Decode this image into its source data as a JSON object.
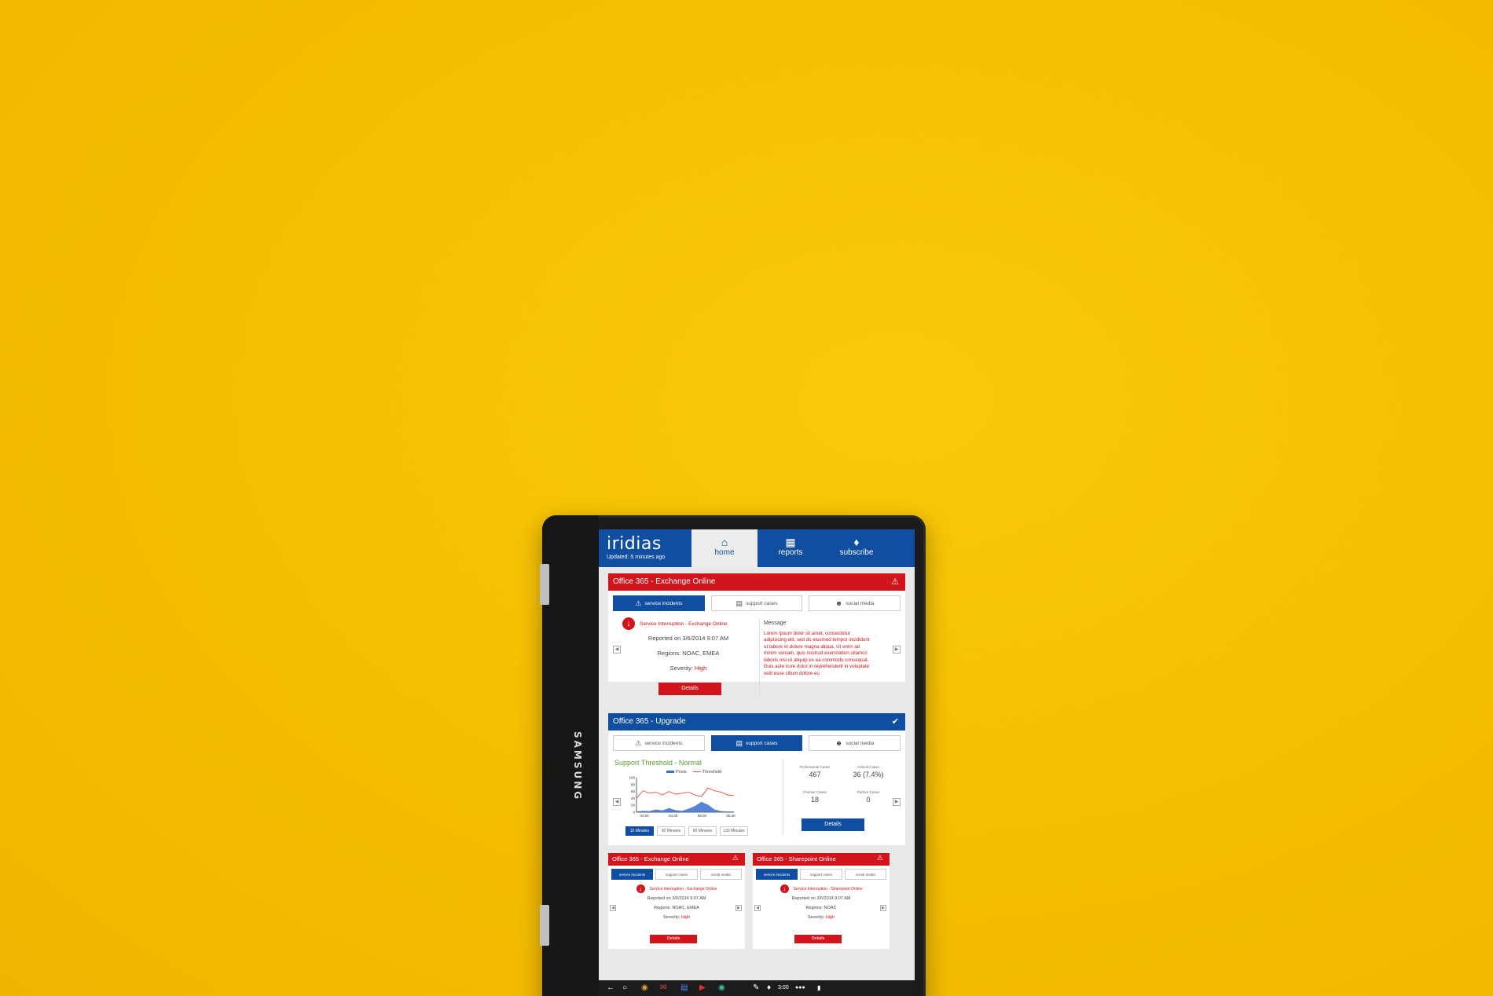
{
  "device": {
    "brand": "SAMSUNG"
  },
  "app": {
    "logo": "iridias",
    "updated": "Updated: 5 minutes ago",
    "nav": [
      {
        "label": "home",
        "icon": "home-icon",
        "active": true
      },
      {
        "label": "reports",
        "icon": "book-icon",
        "active": false
      },
      {
        "label": "subscribe",
        "icon": "bell-icon",
        "active": false
      }
    ]
  },
  "card1": {
    "title": "Office 365 - Exchange Online",
    "status": "warning",
    "tabs": [
      "service incidents",
      "support cases",
      "social media"
    ],
    "active_tab": 0,
    "incident": {
      "link": "Service Interruption - Exchange Online",
      "reported": "Reported on 3/6/2014 9:07 AM",
      "regions": "Regions:  NOAC, EMEA",
      "severity_label": "Severity:",
      "severity": "High",
      "details": "Details"
    },
    "message_label": "Message:",
    "message": "Lorem ipsum dolor sit amet, consectetur adipisicing elit, sed do eiusmod tempor incididunt ut labore et dolore magna aliqua. Ut enim ad minim veniam, quis nostrud exercitation ullamco laboris nisi ut aliquip ex ea commodo consequat. Duis aute irure dolor in reprehenderit in voluptate velit esse cillum dolore eu"
  },
  "card2": {
    "title": "Office 365 - Upgrade",
    "status": "ok",
    "tabs": [
      "service incidents",
      "support cases",
      "social media"
    ],
    "active_tab": 1,
    "threshold": "Support Threshold - Normal",
    "legend": [
      "Posts",
      "Threshold"
    ],
    "time_buttons": [
      "15 Minutes",
      "30 Minutes",
      "60 Minutes",
      "120 Minutes"
    ],
    "stats": [
      {
        "label": "Professional Cases",
        "value": "467"
      },
      {
        "label": "Critical Cases",
        "value": "36 (7.4%)"
      },
      {
        "label": "Premier Cases",
        "value": "18"
      },
      {
        "label": "Partner Cases",
        "value": "0"
      }
    ],
    "details": "Details"
  },
  "chart_data": {
    "type": "area",
    "title": "Support Threshold - Normal",
    "x": [
      "04:00",
      "04:30",
      "05:00",
      "05:30"
    ],
    "ylim": [
      0,
      100
    ],
    "yticks": [
      0,
      20,
      40,
      60,
      80,
      100
    ],
    "legend_position": "top",
    "series": [
      {
        "name": "Posts",
        "color": "#3b6fd1",
        "values": [
          2,
          4,
          3,
          8,
          5,
          12,
          6,
          4,
          10,
          18,
          30,
          22,
          8,
          3,
          2,
          2
        ]
      },
      {
        "name": "Threshold",
        "color": "#e2563e",
        "values": [
          40,
          62,
          55,
          58,
          50,
          60,
          52,
          55,
          58,
          50,
          45,
          70,
          62,
          58,
          50,
          48
        ]
      }
    ]
  },
  "card3": {
    "title": "Office 365 - Exchange Online",
    "tabs": [
      "service incidents",
      "support cases",
      "social media"
    ],
    "link": "Service Interruption - Exchange Online",
    "reported": "Reported on 3/6/2014 9:07 AM",
    "regions": "Regions:  NOAC, EMEA",
    "severity_label": "Severity:",
    "severity": "High",
    "details": "Details"
  },
  "card4": {
    "title": "Office 365 - Sharepoint Online",
    "tabs": [
      "service incidents",
      "support cases",
      "social media"
    ],
    "link": "Service Interruption - Sharepoint Online",
    "reported": "Reported on 3/6/2014 9:07 AM",
    "regions": "Regions:  NOAC",
    "severity_label": "Severity:",
    "severity": "High",
    "details": "Details"
  },
  "shelf": {
    "time": "3:00"
  }
}
